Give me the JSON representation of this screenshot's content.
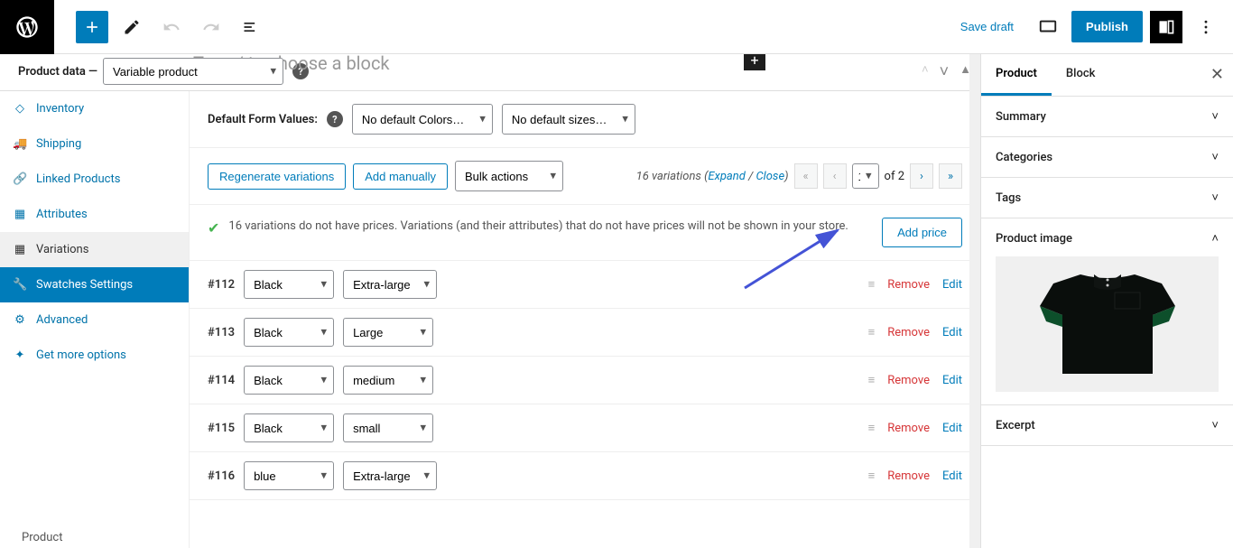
{
  "topbar": {
    "save_draft": "Save draft",
    "publish": "Publish"
  },
  "editor": {
    "placeholder": "Type / to choose a block"
  },
  "product_data": {
    "label": "Product data —",
    "type": "Variable product",
    "tabs": {
      "inventory": "Inventory",
      "shipping": "Shipping",
      "linked": "Linked Products",
      "attributes": "Attributes",
      "variations": "Variations",
      "swatches": "Swatches Settings",
      "advanced": "Advanced",
      "more": "Get more options"
    }
  },
  "form": {
    "default_values_label": "Default Form Values:",
    "colors_default": "No default Colors…",
    "sizes_default": "No default sizes…"
  },
  "actions": {
    "regenerate": "Regenerate variations",
    "add_manually": "Add manually",
    "bulk": "Bulk actions",
    "count_text": "16 variations (",
    "expand": "Expand",
    "slash": " / ",
    "close": "Close",
    "end": ")",
    "page": "1",
    "of_total": "of 2"
  },
  "notice": {
    "text": "16 variations do not have prices. Variations (and their attributes) that do not have prices will not be shown in your store.",
    "add_price": "Add price"
  },
  "variations": [
    {
      "id": "#112",
      "color": "Black",
      "size": "Extra-large"
    },
    {
      "id": "#113",
      "color": "Black",
      "size": "Large"
    },
    {
      "id": "#114",
      "color": "Black",
      "size": "medium"
    },
    {
      "id": "#115",
      "color": "Black",
      "size": "small"
    },
    {
      "id": "#116",
      "color": "blue",
      "size": "Extra-large"
    }
  ],
  "var_actions": {
    "remove": "Remove",
    "edit": "Edit"
  },
  "right_panel": {
    "tab_product": "Product",
    "tab_block": "Block",
    "summary": "Summary",
    "categories": "Categories",
    "tags": "Tags",
    "product_image": "Product image",
    "excerpt": "Excerpt"
  },
  "footer": {
    "status": "Product"
  }
}
